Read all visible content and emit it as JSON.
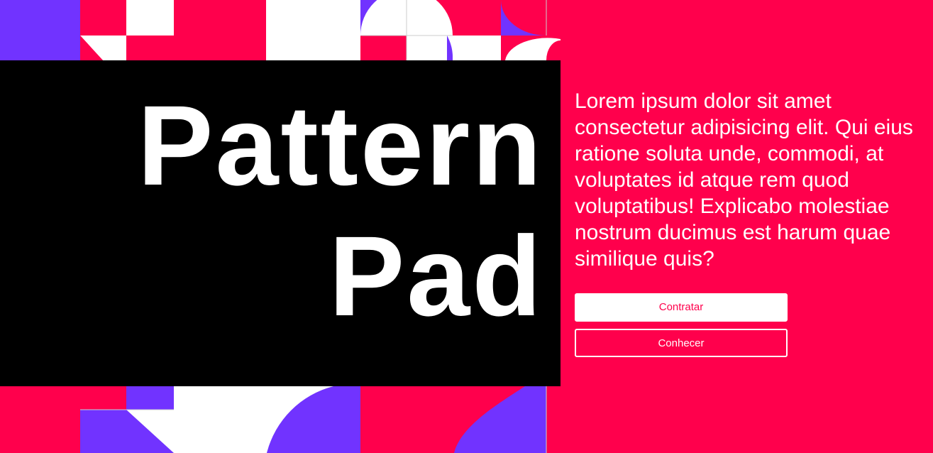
{
  "colors": {
    "accent": "#ff004c",
    "purple": "#7133ff",
    "hero_bg": "#000000",
    "text": "#ffffff"
  },
  "hero": {
    "title_line_1": "Pattern",
    "title_line_2": "Pad"
  },
  "content": {
    "description": "Lorem ipsum dolor sit amet consectetur adipisicing elit. Qui eius ratione soluta unde, commodi, at voluptates id atque rem quod voluptatibus! Explicabo molestiae nostrum ducimus est harum quae similique quis?",
    "primary_button": "Contratar",
    "secondary_button": "Conhecer"
  }
}
